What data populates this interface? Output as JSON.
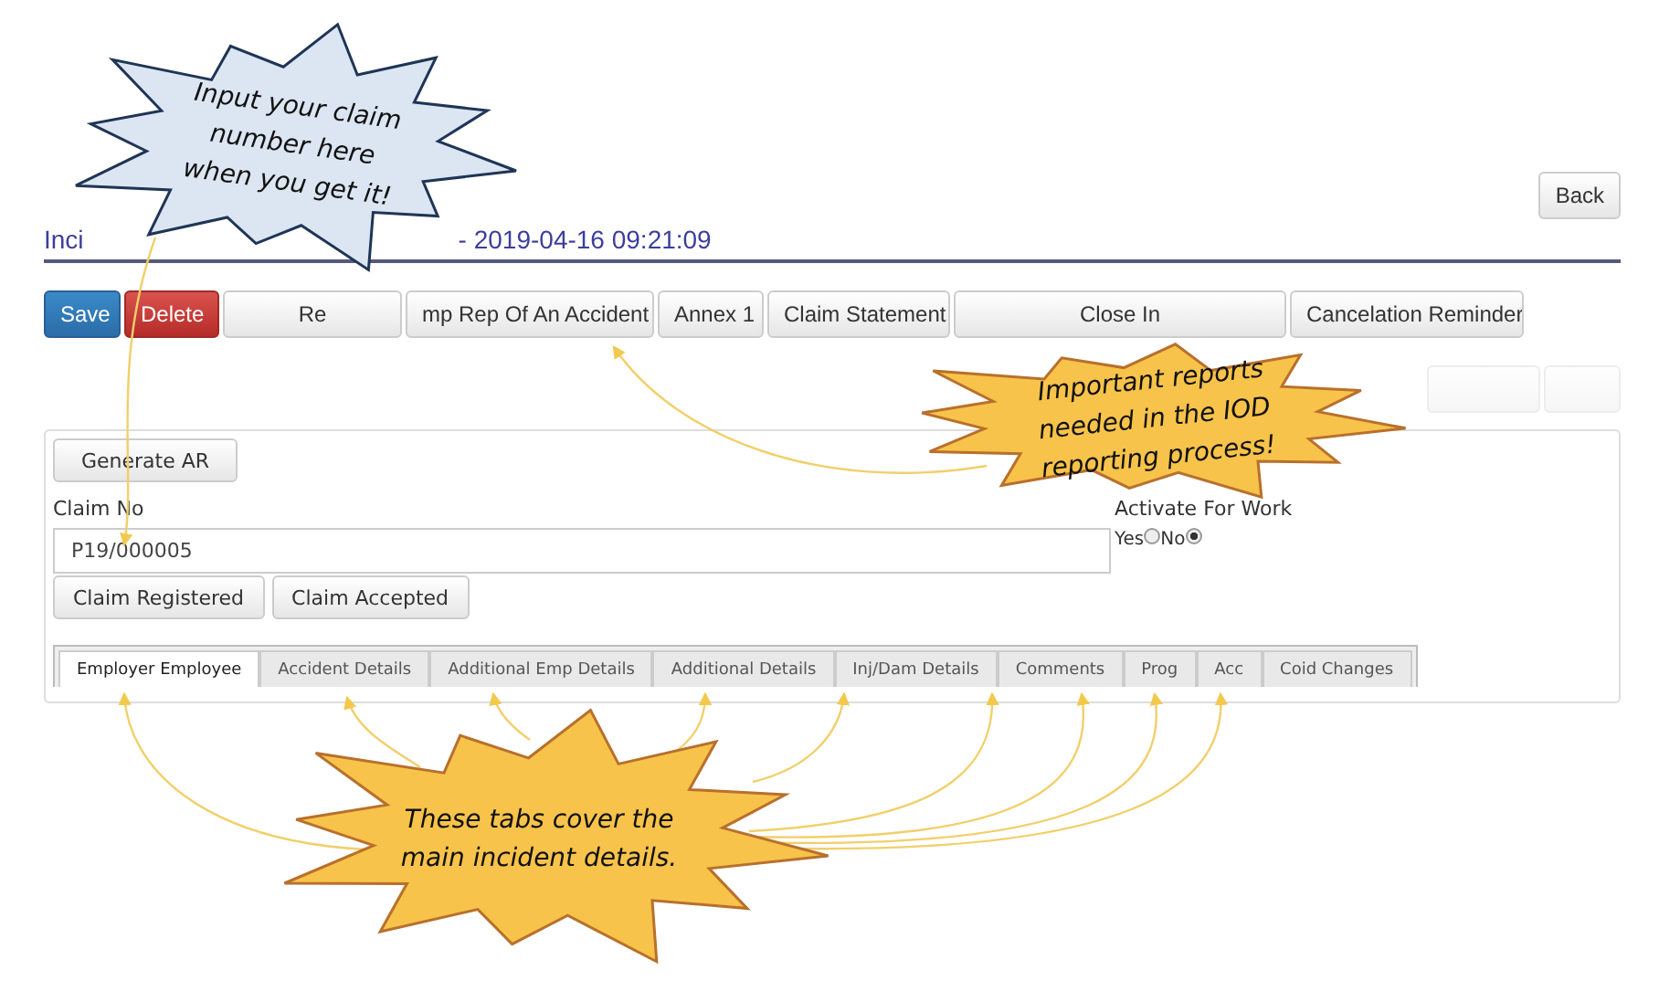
{
  "back_button": "Back",
  "title": {
    "start": "Inci",
    "end": "- 2019-04-16 09:21:09"
  },
  "toolbar": [
    {
      "label": "Save",
      "kind": "primary"
    },
    {
      "label": "Delete",
      "kind": "danger"
    },
    {
      "label": "Re",
      "kind": "default"
    },
    {
      "label": "mp Rep Of An Accident",
      "kind": "default"
    },
    {
      "label": "Annex 1",
      "kind": "default"
    },
    {
      "label": "Claim Statement",
      "kind": "default"
    },
    {
      "label": "Close In",
      "kind": "default"
    },
    {
      "label": "Cancelation Reminder",
      "kind": "default"
    }
  ],
  "action_buttons": [
    {
      "disabled": true
    },
    {
      "disabled": true
    }
  ],
  "form": {
    "generate_button": "Generate AR",
    "claim_label": "Claim No",
    "claim_value": "P19/000005",
    "status_buttons": [
      "Claim Registered",
      "Claim Accepted"
    ],
    "activate_label": "Activate For Work",
    "radios": [
      {
        "label": "Yes",
        "selected": false
      },
      {
        "label": "No",
        "selected": true
      }
    ]
  },
  "tabs": [
    {
      "label": "Employer Employee",
      "selected": true
    },
    {
      "label": "Accident Details",
      "selected": false
    },
    {
      "label": "Additional Emp Details",
      "selected": false
    },
    {
      "label": "Additional Details",
      "selected": false
    },
    {
      "label": "Inj/Dam Details",
      "selected": false
    },
    {
      "label": "Comments",
      "selected": false
    },
    {
      "label": "Prog",
      "selected": false
    },
    {
      "label": "Acc",
      "selected": false
    },
    {
      "label": "Coid Changes",
      "selected": false
    }
  ],
  "callouts": [
    {
      "kind": "blue",
      "lines": [
        "Input your claim",
        "number here",
        "when you get it!"
      ]
    },
    {
      "kind": "gold",
      "lines": [
        "Important reports",
        "needed in the IOD",
        "reporting process!"
      ]
    },
    {
      "kind": "gold",
      "lines": [
        "These tabs cover the",
        "main incident details."
      ]
    }
  ]
}
